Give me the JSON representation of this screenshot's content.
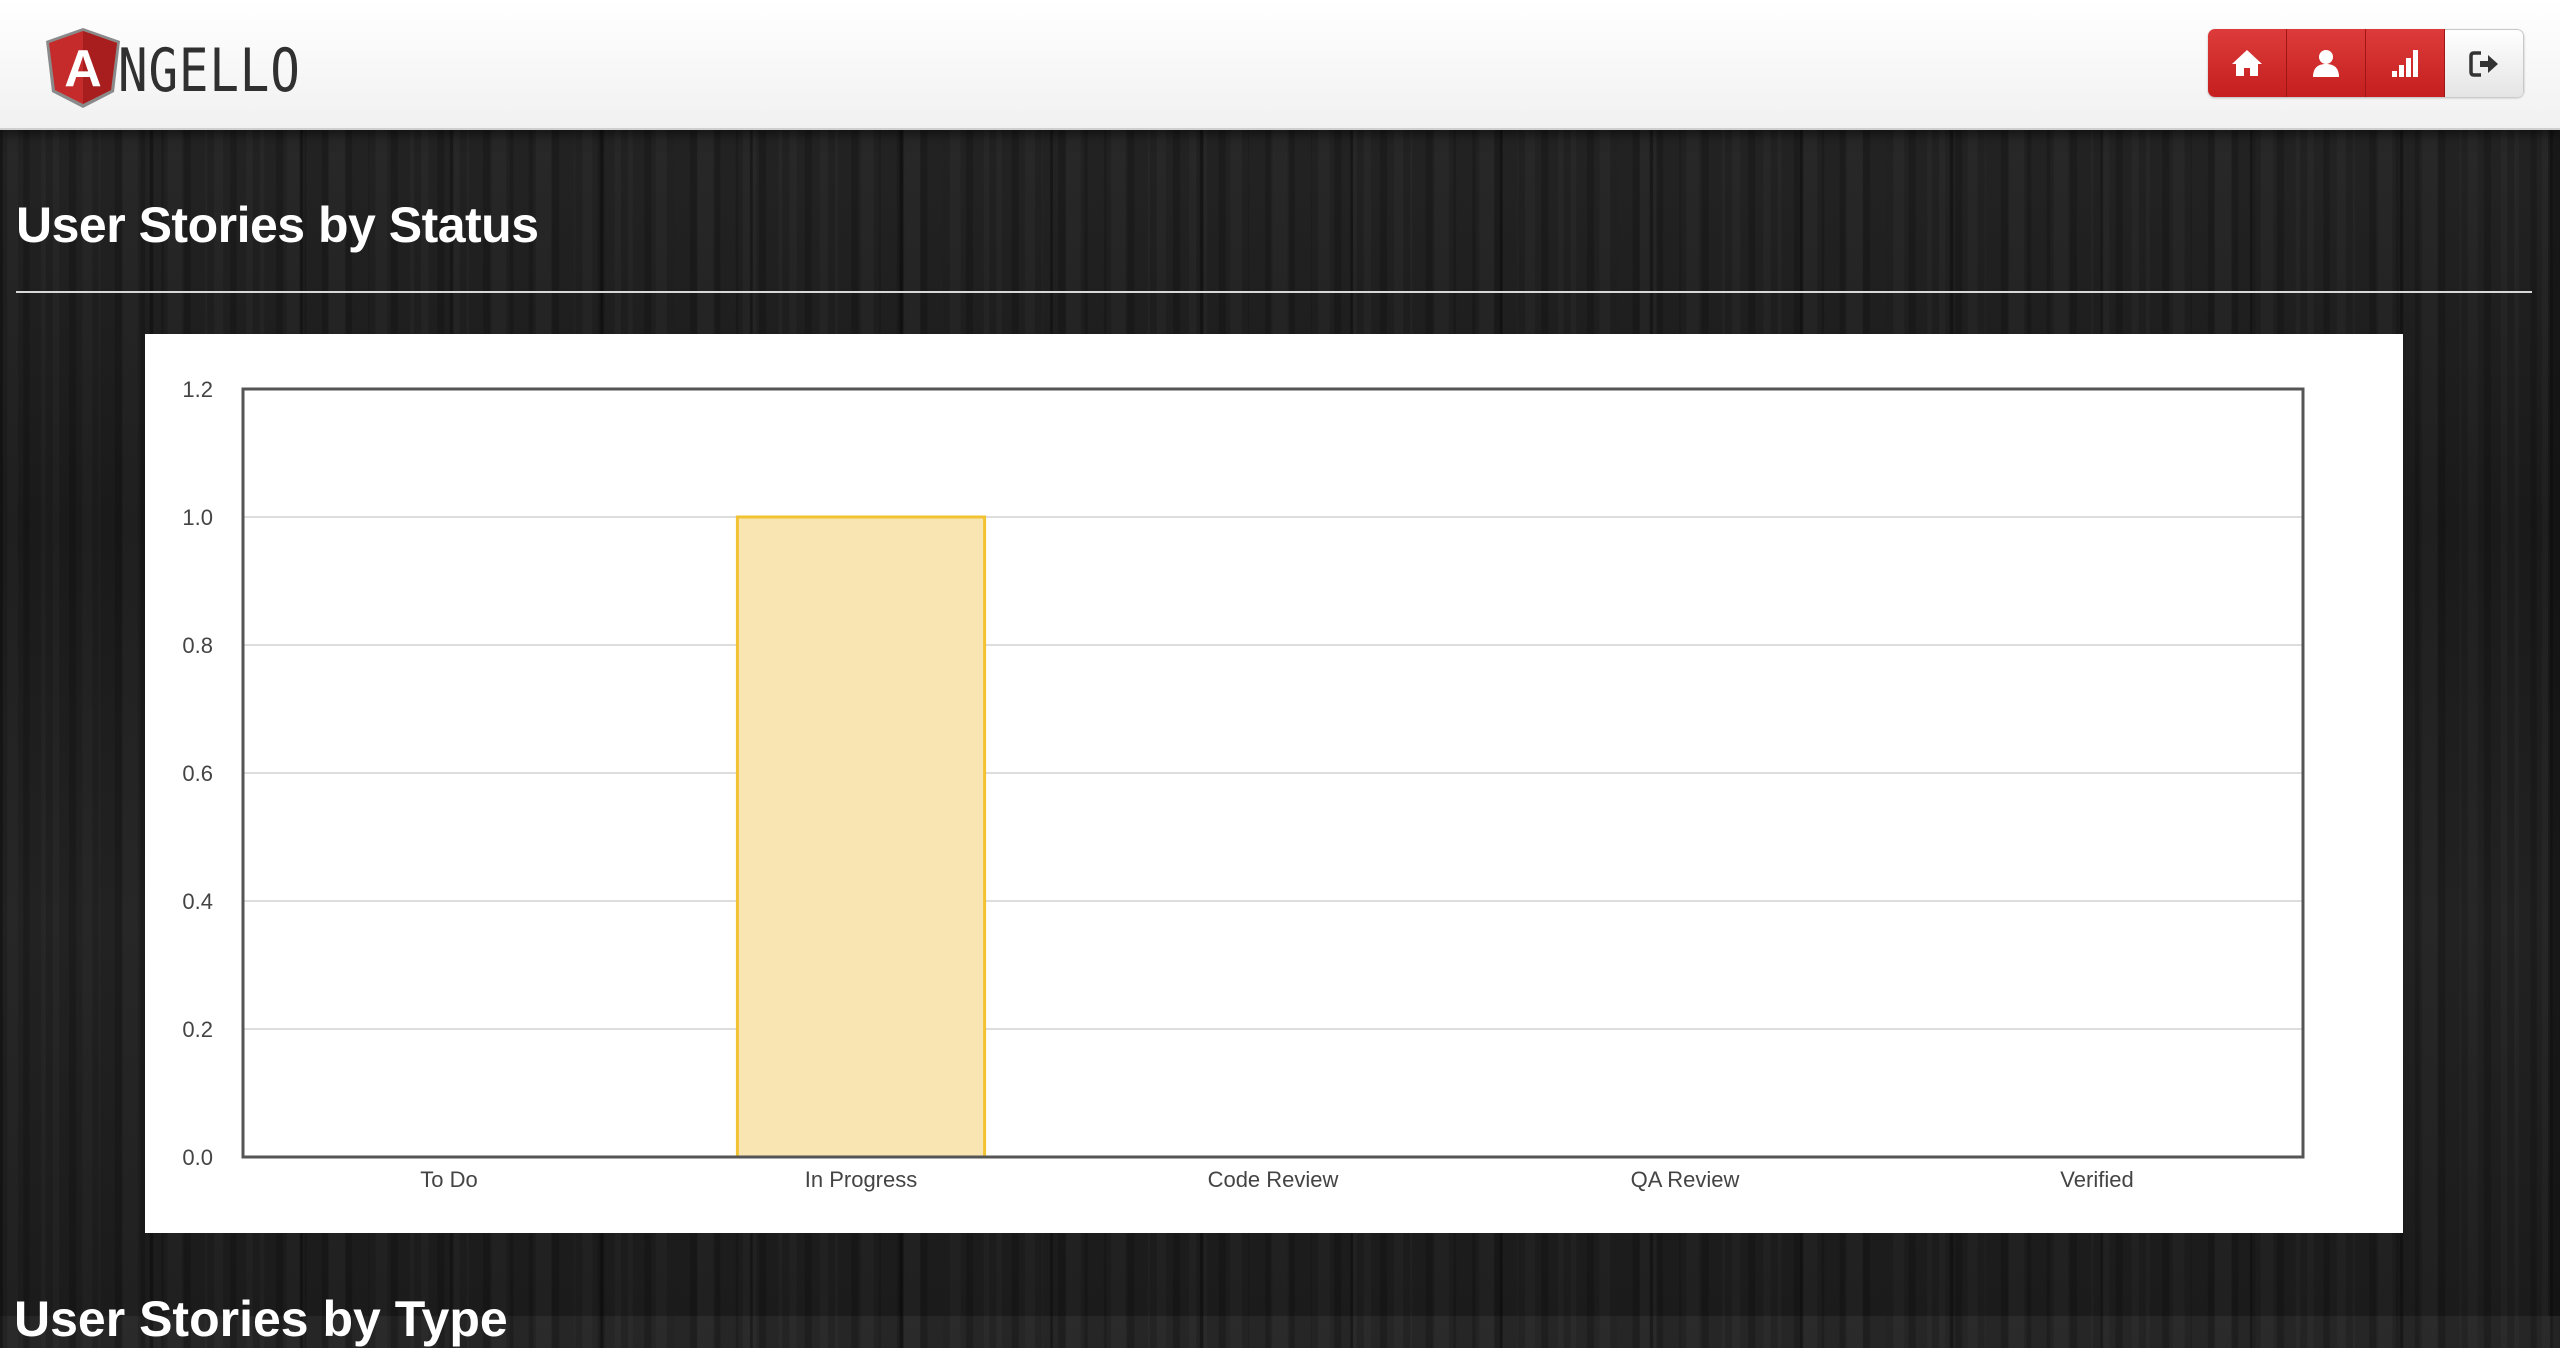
{
  "app": {
    "logo_text": "NGELLO",
    "logo_letter": "A",
    "brand_color": "#c52b2b"
  },
  "nav": {
    "buttons": [
      {
        "icon": "home-icon"
      },
      {
        "icon": "user-icon"
      },
      {
        "icon": "stats-icon"
      },
      {
        "icon": "logout-icon"
      }
    ]
  },
  "sections": {
    "status_title": "User Stories by Status",
    "type_title": "User Stories by Type"
  },
  "chart_data": {
    "type": "bar",
    "categories": [
      "To Do",
      "In Progress",
      "Code Review",
      "QA Review",
      "Verified"
    ],
    "values": [
      0,
      1,
      0,
      0,
      0
    ],
    "ylim": [
      0,
      1.2
    ],
    "yticks": [
      "0.0",
      "0.2",
      "0.4",
      "0.6",
      "0.8",
      "1.0",
      "1.2"
    ],
    "grid": true,
    "bar_fill": "#f8e5b1",
    "bar_stroke": "#f1c232"
  }
}
